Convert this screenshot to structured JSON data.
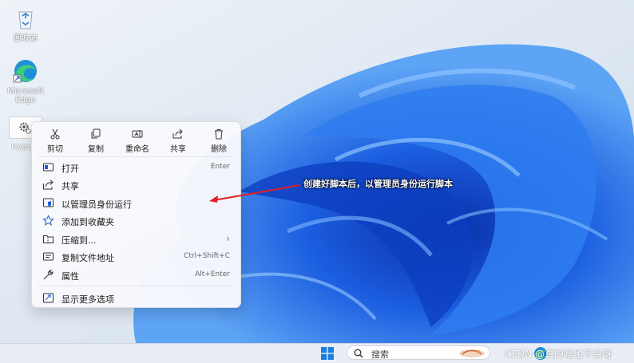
{
  "desktop": {
    "icons": [
      {
        "label": "回收站",
        "icon": "recycle-bin-icon"
      },
      {
        "label": "Microsoft\nEdge",
        "icon": "edge-icon"
      },
      {
        "label": "Hype",
        "icon": "gear-icon"
      }
    ]
  },
  "context_menu": {
    "toolbar": [
      {
        "label": "剪切",
        "icon": "scissors-icon"
      },
      {
        "label": "复制",
        "icon": "copy-icon"
      },
      {
        "label": "重命名",
        "icon": "rename-icon"
      },
      {
        "label": "共享",
        "icon": "share-icon"
      },
      {
        "label": "删除",
        "icon": "trash-icon"
      }
    ],
    "items": [
      {
        "label": "打开",
        "shortcut": "Enter",
        "icon": "open-icon"
      },
      {
        "label": "共享",
        "shortcut": "",
        "icon": "share-icon"
      },
      {
        "label": "以管理员身份运行",
        "shortcut": "",
        "icon": "shield-icon"
      },
      {
        "label": "添加到收藏夹",
        "shortcut": "",
        "icon": "star-icon"
      },
      {
        "label": "压缩到...",
        "shortcut": "",
        "icon": "zip-folder-icon",
        "submenu": "›"
      },
      {
        "label": "复制文件地址",
        "shortcut": "Ctrl+Shift+C",
        "icon": "copy-path-icon"
      },
      {
        "label": "属性",
        "shortcut": "Alt+Enter",
        "icon": "wrench-icon"
      },
      {
        "label": "显示更多选项",
        "shortcut": "",
        "icon": "more-options-icon"
      }
    ]
  },
  "annotation": {
    "text": "创建好脚本后，以管理员身份运行脚本",
    "color": "#e02020"
  },
  "taskbar": {
    "search_placeholder": "搜索",
    "watermark": "CSDN @真的啥也不会呀"
  },
  "colors": {
    "wallpaper_bg": "#dfe8f3",
    "wallpaper_blue": "#1a5ad8",
    "accent": "#1e5fd0"
  }
}
